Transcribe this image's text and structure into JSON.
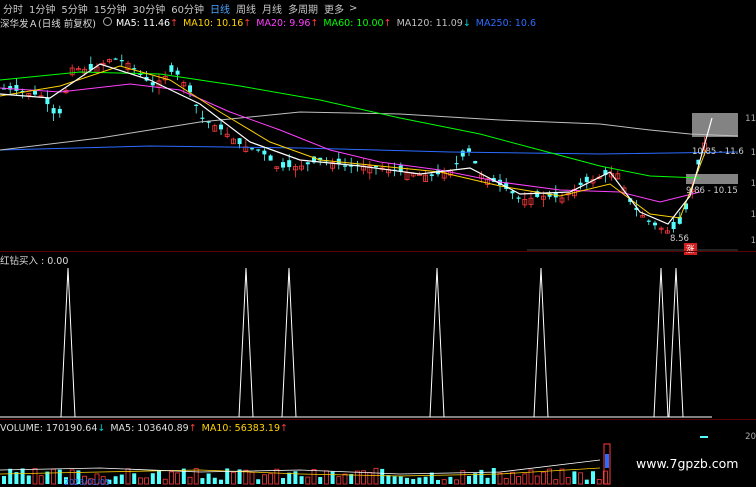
{
  "toolbar": {
    "tabs": [
      {
        "label": "分时",
        "active": false
      },
      {
        "label": "1分钟",
        "active": false
      },
      {
        "label": "5分钟",
        "active": false
      },
      {
        "label": "15分钟",
        "active": false
      },
      {
        "label": "30分钟",
        "active": false
      },
      {
        "label": "60分钟",
        "active": false
      },
      {
        "label": "日线",
        "active": true
      },
      {
        "label": "周线",
        "active": false
      },
      {
        "label": "月线",
        "active": false
      },
      {
        "label": "多周期",
        "active": false
      },
      {
        "label": "更多",
        "active": false
      }
    ],
    "more_arrow": ">"
  },
  "price_pane": {
    "stock": "深华发Ａ(日线 前复权)",
    "ma": [
      {
        "label": "MA5: 11.46",
        "arrow": "↑",
        "color": "#ffffff"
      },
      {
        "label": "MA10: 10.16",
        "arrow": "↑",
        "color": "#ffd200"
      },
      {
        "label": "MA20: 9.96",
        "arrow": "↑",
        "color": "#ff40ff"
      },
      {
        "label": "MA60: 10.00",
        "arrow": "↑",
        "color": "#00ff00"
      },
      {
        "label": "MA120: 11.09",
        "arrow": "↓",
        "color": "#c0c0c0"
      },
      {
        "label": "MA250: 10.6",
        "arrow": "",
        "color": "#2b6cff"
      }
    ],
    "range_high_label": "10.85 - 11.6",
    "range_low_label": "9.86 - 10.15",
    "low_label": "8.56",
    "zhang_tag": "涨",
    "right_axis": [
      "11",
      "1",
      "1",
      "1",
      "1"
    ]
  },
  "indicator_pane": {
    "title": "红钻买入 : 0.00",
    "peaks": [
      68,
      246,
      289,
      437,
      541,
      661,
      676
    ]
  },
  "volume_pane": {
    "label": "VOLUME: 170190.64",
    "label_arrow": "↓",
    "ma5": "MA5: 103640.89",
    "ma5_arrow": "↑",
    "ma10": "MA10: 56383.19",
    "ma10_arrow": "↑",
    "right_axis": "20",
    "bottom_date": "2023/01/05"
  },
  "watermark": "www.7gpzb.com",
  "colors": {
    "up": "#ff3b3b",
    "down": "#54ffff",
    "active_tab": "#4aa3ff",
    "ma5": "#ffffff",
    "ma10": "#ffd200",
    "ma20": "#ff40ff",
    "ma60": "#00ff00",
    "ma120": "#c0c0c0",
    "ma250": "#2b6cff"
  }
}
